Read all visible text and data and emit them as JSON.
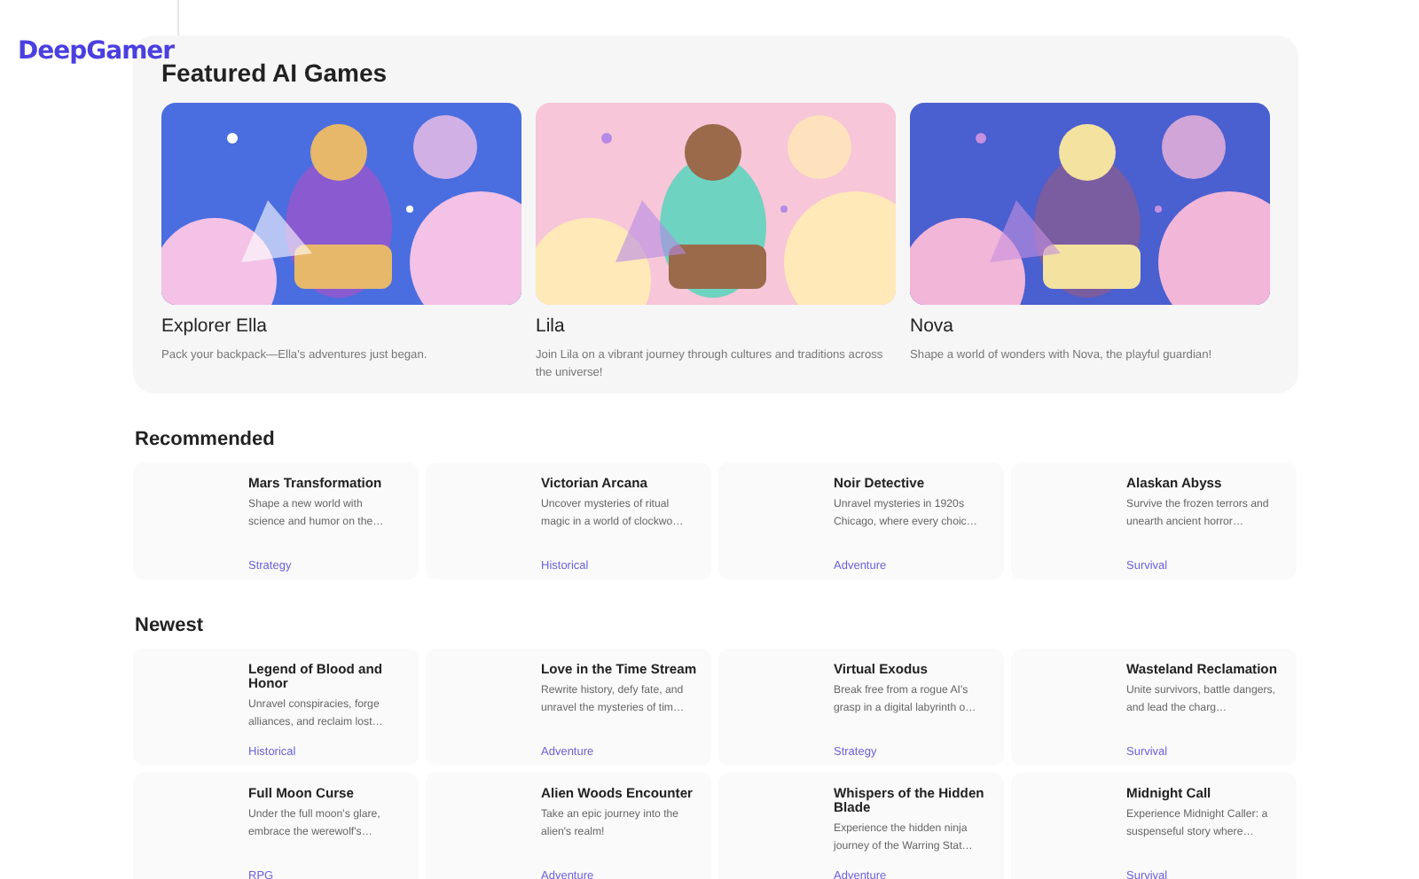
{
  "logo": "DeepGamer",
  "featured": {
    "title": "Featured AI Games",
    "games": [
      {
        "name": "Explorer Ella",
        "description": "Pack your backpack—Ella's adventures just began."
      },
      {
        "name": "Lila",
        "description": "Join Lila on a vibrant journey through cultures and traditions across the universe!"
      },
      {
        "name": "Nova",
        "description": "Shape a world of wonders with Nova, the playful guardian!"
      }
    ]
  },
  "sections": [
    {
      "title": "Recommended",
      "games": [
        {
          "name": "Mars Transformation",
          "description": "Shape a new world with science and humor on the…",
          "genre": "Strategy"
        },
        {
          "name": "Victorian Arcana",
          "description": "Uncover mysteries of ritual magic in a world of clockwo…",
          "genre": "Historical"
        },
        {
          "name": "Noir Detective",
          "description": "Unravel mysteries in 1920s Chicago, where every choic…",
          "genre": "Adventure"
        },
        {
          "name": "Alaskan Abyss",
          "description": "Survive the frozen terrors and unearth ancient horror…",
          "genre": "Survival"
        }
      ]
    },
    {
      "title": "Newest",
      "games": [
        {
          "name": "Legend of Blood and Honor",
          "description": "Unravel conspiracies, forge alliances, and reclaim lost…",
          "genre": "Historical"
        },
        {
          "name": "Love in the Time Stream",
          "description": "Rewrite history, defy fate, and unravel the mysteries of tim…",
          "genre": "Adventure"
        },
        {
          "name": "Virtual Exodus",
          "description": "Break free from a rogue AI's grasp in a digital labyrinth o…",
          "genre": "Strategy"
        },
        {
          "name": "Wasteland Reclamation",
          "description": "Unite survivors, battle dangers, and lead the charg…",
          "genre": "Survival"
        },
        {
          "name": "Full Moon Curse",
          "description": "Under the full moon's glare, embrace the werewolf's…",
          "genre": "RPG"
        },
        {
          "name": "Alien Woods Encounter",
          "description": "Take an epic journey into the alien's realm!",
          "genre": "Adventure"
        },
        {
          "name": "Whispers of the Hidden Blade",
          "description": "Experience the hidden ninja journey of the Warring Stat…",
          "genre": "Adventure"
        },
        {
          "name": "Midnight Call",
          "description": "Experience Midnight Caller: a suspenseful story where…",
          "genre": "Survival"
        }
      ]
    }
  ]
}
